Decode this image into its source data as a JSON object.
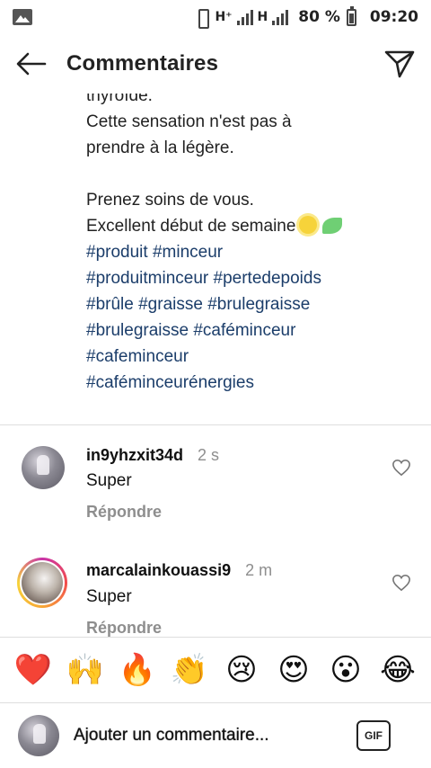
{
  "status_bar": {
    "network_1": "H⁺",
    "network_2": "H",
    "battery": "80 %",
    "time": "09:20"
  },
  "header": {
    "title": "Commentaires"
  },
  "caption": {
    "lines": [
      "thyroïde.",
      "Cette sensation n'est pas à",
      "prendre à la légère.",
      "",
      "Prenez soins de vous.",
      "Excellent début de semaine"
    ],
    "hashtags": [
      [
        "#produit",
        "#minceur"
      ],
      [
        "#produitminceur",
        "#pertedepoids"
      ],
      [
        "#brûle",
        "#graisse",
        "#brulegraisse"
      ],
      [
        "#brulegraisse",
        "#caféminceur"
      ],
      [
        "#cafeminceur"
      ],
      [
        "#caféminceurénergies"
      ]
    ]
  },
  "comments": [
    {
      "username": "in9yhzxit34d",
      "time": "2 s",
      "text": "Super",
      "reply_label": "Répondre"
    },
    {
      "username": "marcalainkouassi9",
      "time": "2 m",
      "text": "Super",
      "reply_label": "Répondre"
    }
  ],
  "emoji_bar": [
    "❤️",
    "🙌",
    "🔥",
    "👏",
    "😢",
    "😍",
    "😮",
    "😂"
  ],
  "composer": {
    "placeholder": "Ajouter un commentaire...",
    "gif_label": "GIF"
  }
}
